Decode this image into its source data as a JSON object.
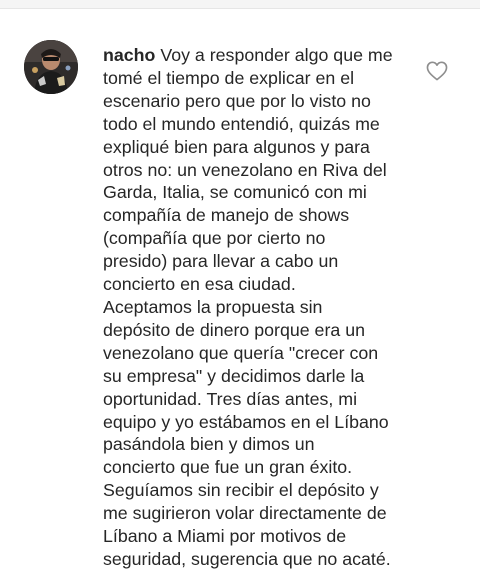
{
  "comment": {
    "username": "nacho",
    "first_line_rest": " Voy a responder algo que me",
    "lines": [
      "tomé el tiempo de explicar en el",
      "escenario pero que por lo visto no",
      "todo el mundo entendió, quizás me",
      "expliqué bien para algunos y para",
      "otros no: un venezolano en Riva del",
      "Garda, Italia, se comunicó con mi",
      "compañía de manejo de shows",
      "(compañía que por cierto no",
      "presido) para llevar a cabo un",
      "concierto en esa ciudad.",
      "Aceptamos la propuesta sin",
      "depósito de dinero porque era un",
      "venezolano que quería \"crecer con",
      "su empresa\" y decidimos darle la",
      "oportunidad. Tres días antes, mi",
      "equipo y yo estábamos en el Líbano",
      "pasándola bien y dimos un",
      "concierto que fue un gran éxito.",
      "Seguíamos sin recibir el depósito y",
      "me sugirieron volar directamente de",
      "Líbano a Miami por motivos de",
      "seguridad, sugerencia que no acaté."
    ]
  },
  "icons": {
    "like": "heart-outline-icon",
    "avatar": "user-avatar"
  },
  "colors": {
    "text": "#262626",
    "icon": "#8e8e8e",
    "background": "#ffffff"
  }
}
